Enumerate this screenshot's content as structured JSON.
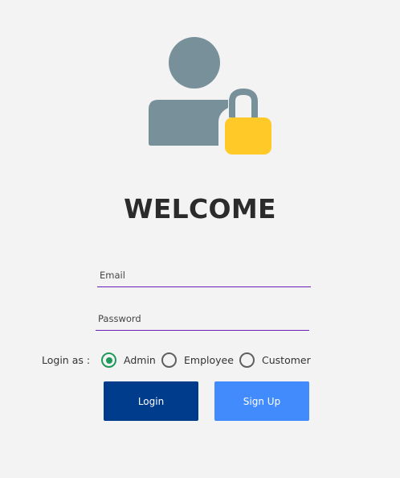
{
  "header": {
    "icon": "user-lock-icon",
    "title": "WELCOME"
  },
  "form": {
    "email_placeholder": "Email",
    "password_placeholder": "Password",
    "login_as_label": "Login as :",
    "roles": [
      {
        "label": "Admin",
        "selected": true
      },
      {
        "label": "Employee",
        "selected": false
      },
      {
        "label": "Customer",
        "selected": false
      }
    ],
    "login_button": "Login",
    "signup_button": "Sign Up"
  },
  "colors": {
    "background": "#f3f3f3",
    "avatar": "#78909a",
    "lock": "#ffca28",
    "field_underline": "#6a1fb8",
    "radio_selected": "#1f9a5a",
    "login_button": "#003c8c",
    "signup_button": "#428bfd"
  }
}
